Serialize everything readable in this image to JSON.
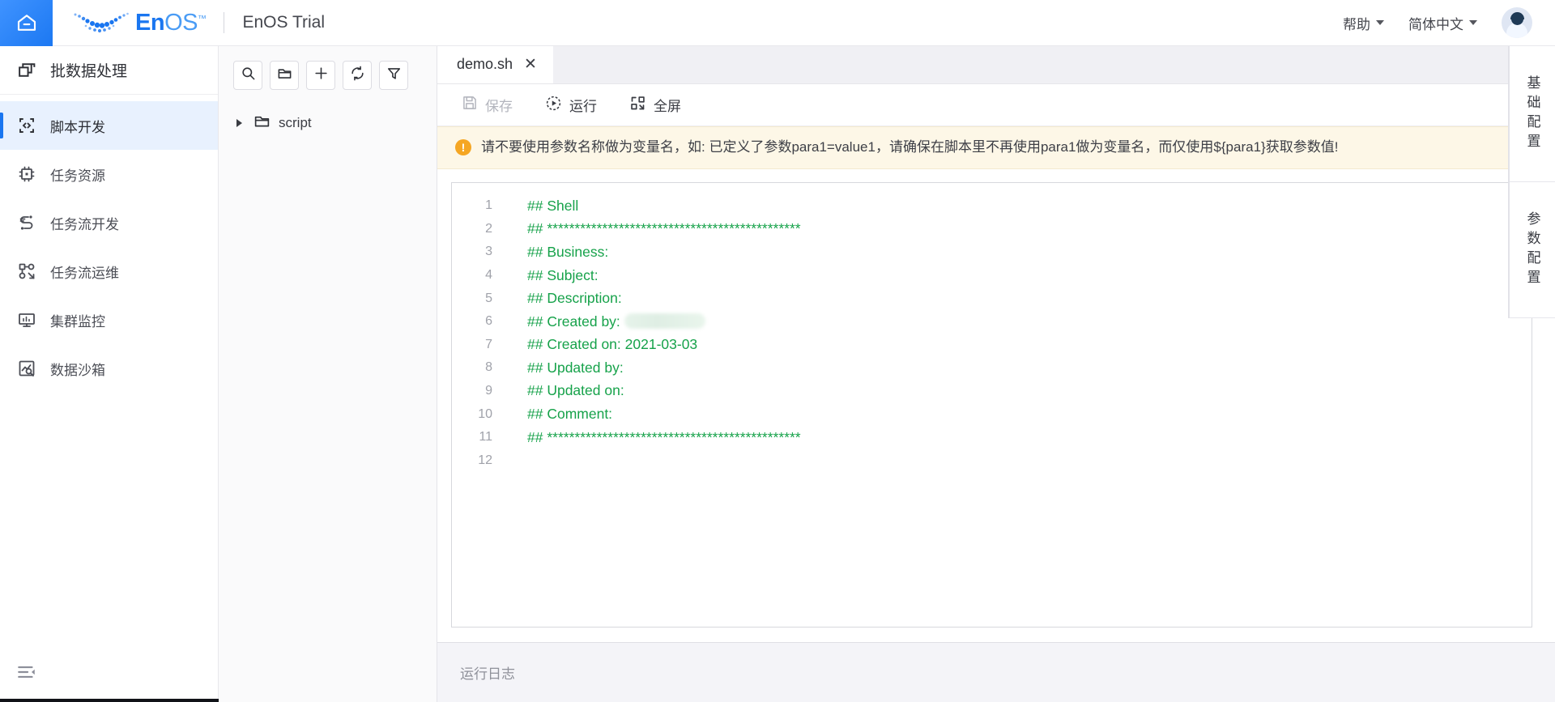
{
  "topbar": {
    "home_icon": "home-icon",
    "brand_en": "En",
    "brand_os": "OS",
    "brand_tm": "™",
    "product_title": "EnOS Trial",
    "help_label": "帮助",
    "language_label": "简体中文",
    "avatar_icon": "user-avatar-icon"
  },
  "sidebar": {
    "module_title": "批数据处理",
    "module_icon": "batch-data-icon",
    "items": [
      {
        "label": "脚本开发",
        "icon": "code-brackets-icon",
        "active": true
      },
      {
        "label": "任务资源",
        "icon": "cpu-chip-icon",
        "active": false
      },
      {
        "label": "任务流开发",
        "icon": "workflow-dev-icon",
        "active": false
      },
      {
        "label": "任务流运维",
        "icon": "workflow-ops-icon",
        "active": false
      },
      {
        "label": "集群监控",
        "icon": "cluster-monitor-icon",
        "active": false
      },
      {
        "label": "数据沙箱",
        "icon": "data-sandbox-icon",
        "active": false
      }
    ],
    "collapse_icon": "collapse-sidebar-icon"
  },
  "tree_panel": {
    "toolbar": [
      {
        "name": "search-icon",
        "title": "搜索"
      },
      {
        "name": "new-folder-icon",
        "title": "新建文件夹"
      },
      {
        "name": "plus-icon",
        "title": "新建"
      },
      {
        "name": "refresh-icon",
        "title": "刷新"
      },
      {
        "name": "filter-icon",
        "title": "筛选"
      }
    ],
    "nodes": [
      {
        "label": "script",
        "icon": "folder-icon",
        "expanded": false
      }
    ]
  },
  "editor": {
    "tabs": [
      {
        "label": "demo.sh",
        "close": "✕",
        "active": true
      }
    ],
    "actions": [
      {
        "label": "保存",
        "icon": "save-icon",
        "disabled": true
      },
      {
        "label": "运行",
        "icon": "run-icon",
        "disabled": false
      },
      {
        "label": "全屏",
        "icon": "fullscreen-icon",
        "disabled": false
      }
    ],
    "warning": {
      "icon": "warning-icon",
      "text": "请不要使用参数名称做为变量名，如: 已定义了参数para1=value1，请确保在脚本里不再使用para1做为变量名，而仅使用${para1}获取参数值!"
    },
    "code": {
      "language": "shell",
      "comment_color": "#16a24a",
      "lines": [
        {
          "no": "1",
          "text": "## Shell"
        },
        {
          "no": "2",
          "text": "## **********************************************"
        },
        {
          "no": "3",
          "text": "## Business:"
        },
        {
          "no": "4",
          "text": "## Subject:"
        },
        {
          "no": "5",
          "text": "## Description:"
        },
        {
          "no": "6",
          "text": "## Created by: ",
          "redacted": true
        },
        {
          "no": "7",
          "text": "## Created on: 2021-03-03"
        },
        {
          "no": "8",
          "text": "## Updated by:"
        },
        {
          "no": "9",
          "text": "## Updated on:"
        },
        {
          "no": "10",
          "text": "## Comment:"
        },
        {
          "no": "11",
          "text": "## **********************************************"
        },
        {
          "no": "12",
          "text": ""
        }
      ]
    },
    "log_placeholder": "运行日志"
  },
  "right_rail": {
    "tabs": [
      {
        "label": "基础配置"
      },
      {
        "label": "参数配置"
      }
    ]
  },
  "colors": {
    "accent": "#1a76f0",
    "active_nav_bg": "#e8f1fe",
    "warning_bg": "#fdf7e7",
    "warning_icon": "#f5a623",
    "code_green": "#16a24a",
    "log_bg": "#f4f4f8"
  }
}
